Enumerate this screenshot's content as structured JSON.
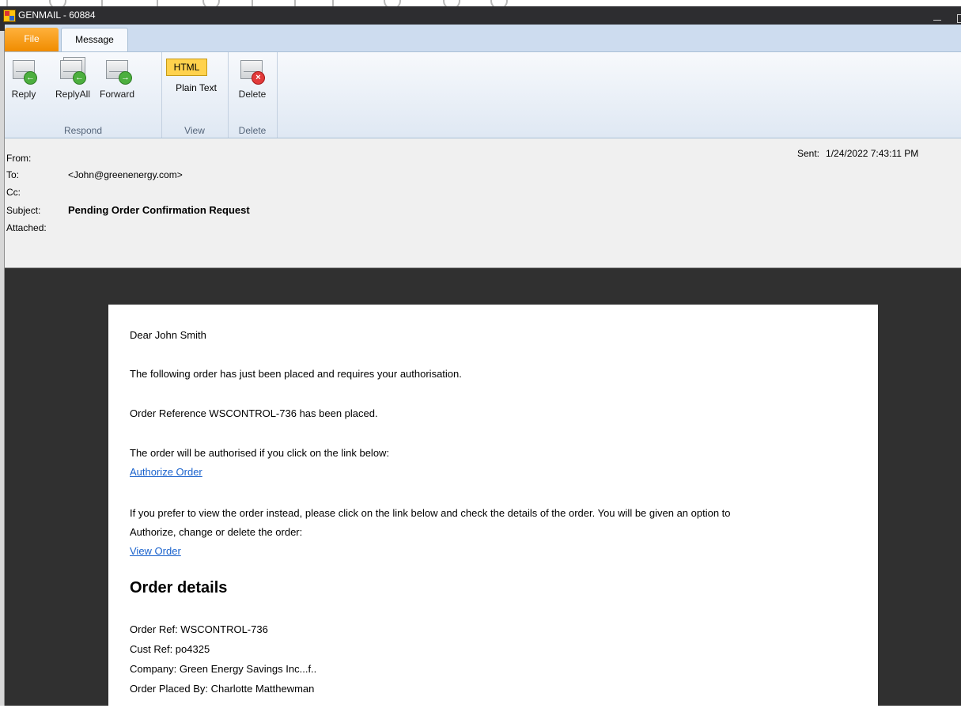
{
  "window": {
    "title": "GENMAIL - 60884"
  },
  "ribbon": {
    "tabs": [
      {
        "label": "File"
      },
      {
        "label": "Message"
      }
    ],
    "respond": {
      "label": "Respond",
      "reply": "Reply",
      "reply_all": "ReplyAll",
      "forward": "Forward"
    },
    "view": {
      "label": "View",
      "html": "HTML",
      "plain_text": "Plain Text"
    },
    "delete": {
      "label": "Delete",
      "button": "Delete"
    }
  },
  "header": {
    "from_label": "From:",
    "from_value": "",
    "to_label": "To:",
    "to_value": "<John@greenenergy.com>",
    "cc_label": "Cc:",
    "subject_label": "Subject:",
    "subject_value": "Pending Order Confirmation Request",
    "attached_label": "Attached:",
    "sent_label": "Sent:",
    "sent_value": "1/24/2022 7:43:11 PM"
  },
  "body": {
    "greeting": "Dear John Smith",
    "line1": "The following order has just been placed and requires your authorisation.",
    "line2": "Order Reference WSCONTROL-736 has been placed.",
    "line3": "The order will be authorised if you click on the link below:",
    "authorize_link": "Authorize Order",
    "line4a": "If you prefer to view the order instead, please click on the link below and check the details of the order. You will be given an option to",
    "line4b": "Authorize, change or delete the order:",
    "view_link": "View Order",
    "details_heading": "Order details",
    "order_ref": "Order Ref: WSCONTROL-736",
    "cust_ref": "Cust Ref: po4325",
    "company": "Company: Green Energy Savings Inc...f..",
    "placed_by": "Order Placed By: Charlotte Matthewman"
  },
  "colors": {
    "accent_file_tab": "#f08c00",
    "link": "#1a62cc",
    "html_toggle": "#ffd24d"
  }
}
